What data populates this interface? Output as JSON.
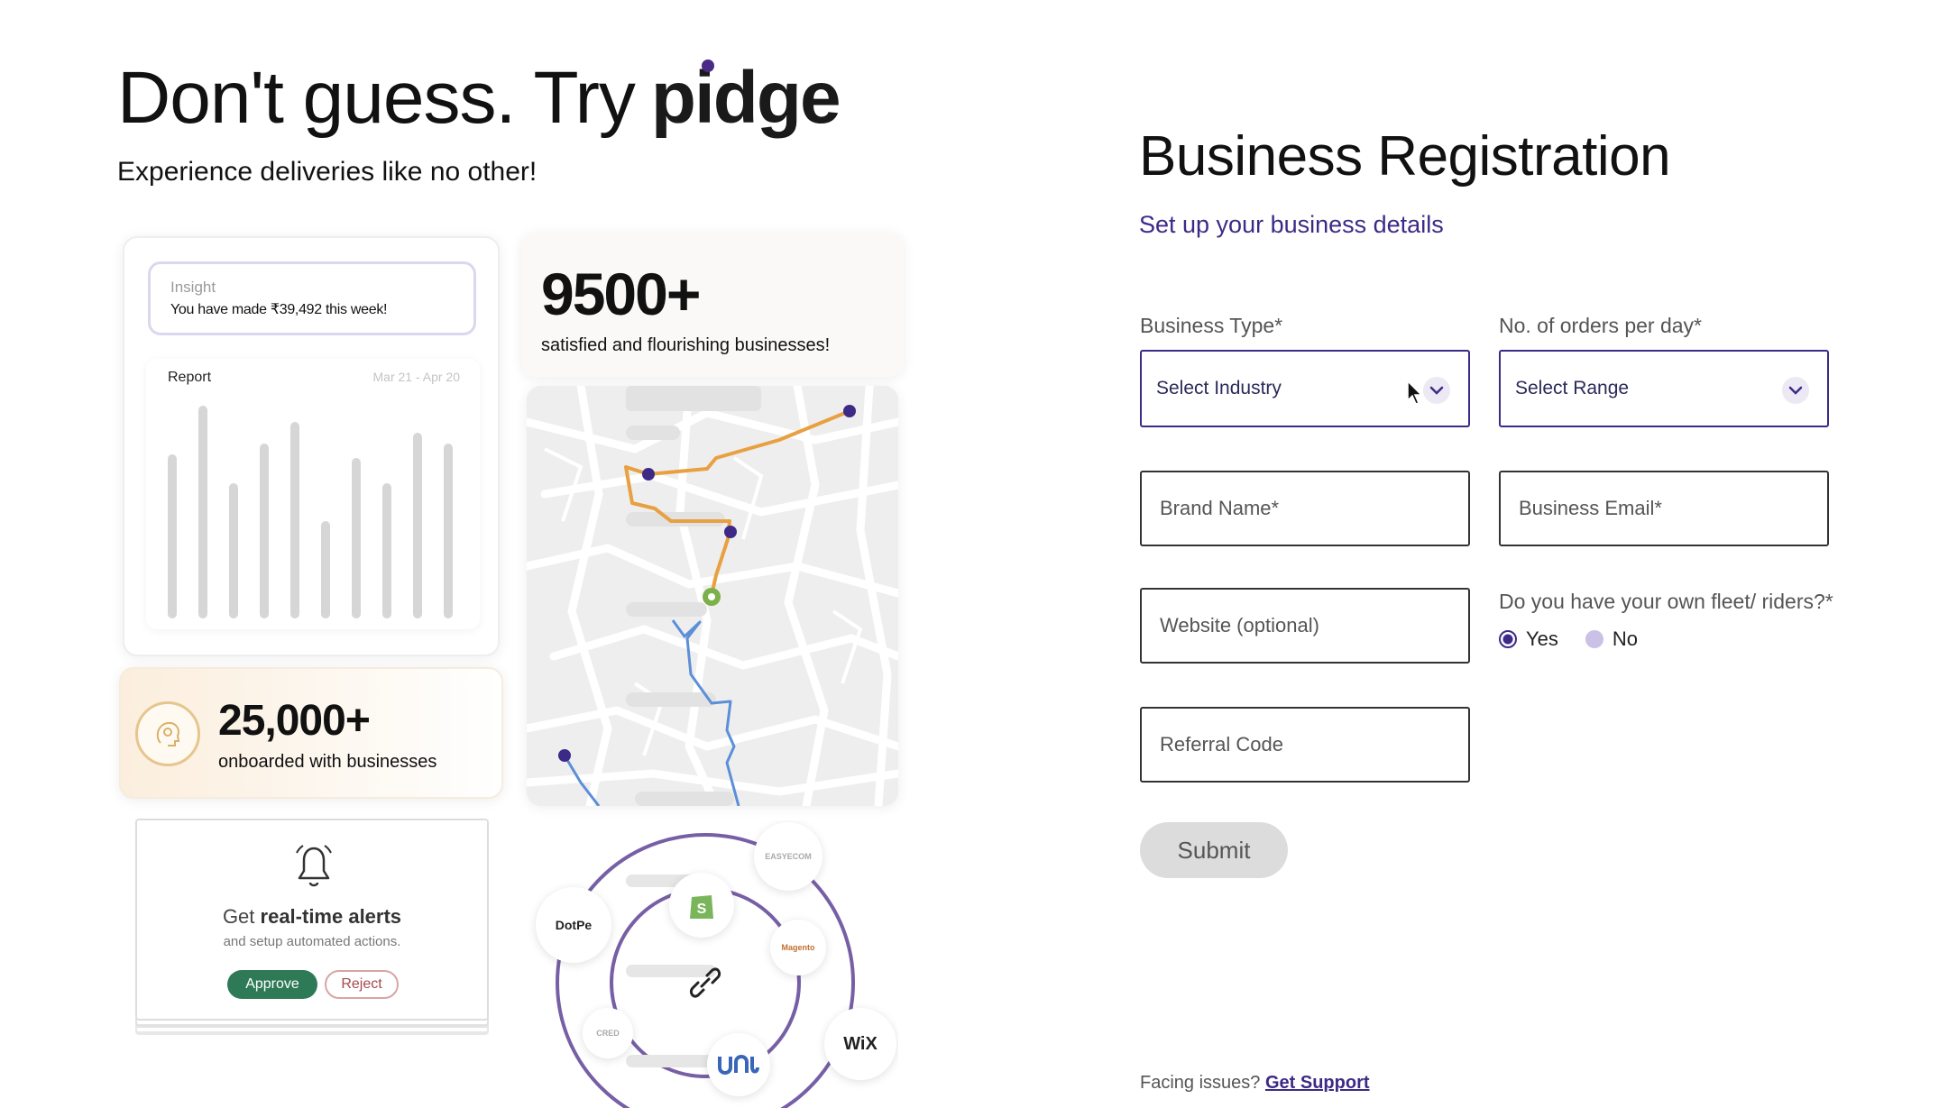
{
  "hero": {
    "title_prefix": "Don't guess. Try",
    "brand": "pidge",
    "subtitle": "Experience deliveries like no other!"
  },
  "insight_card": {
    "label": "Insight",
    "text": "You have made ₹39,492 this week!",
    "report_title": "Report",
    "report_range": "Mar 21 - Apr 20"
  },
  "stats": {
    "number": "9500+",
    "text": "satisfied and flourishing businesses!"
  },
  "onboarded": {
    "number": "25,000+",
    "text": "onboarded with businesses"
  },
  "alert_card": {
    "title_prefix": "Get ",
    "title_bold": "real-time alerts",
    "subtitle": "and setup automated actions.",
    "approve_label": "Approve",
    "reject_label": "Reject"
  },
  "integrations": {
    "badges": [
      "DotPe",
      "EASYECOM",
      "Magento",
      "WiX",
      "CRED"
    ]
  },
  "form": {
    "title": "Business Registration",
    "subtitle": "Set up your business details",
    "business_type_label": "Business Type*",
    "business_type_value": "Select Industry",
    "orders_label": "No. of orders per day*",
    "orders_value": "Select Range",
    "brand_name_placeholder": "Brand Name*",
    "business_email_placeholder": "Business Email*",
    "website_placeholder": "Website (optional)",
    "referral_placeholder": "Referral Code",
    "fleet_question": "Do you have your own fleet/ riders?*",
    "fleet_yes": "Yes",
    "fleet_no": "No",
    "fleet_selected": "Yes",
    "submit_label": "Submit"
  },
  "support": {
    "prefix": "Facing issues? ",
    "link": "Get Support"
  },
  "colors": {
    "accent": "#3d2a86",
    "approve": "#2f7a56",
    "route_orange": "#e8a040",
    "route_blue": "#5b8fd8"
  }
}
